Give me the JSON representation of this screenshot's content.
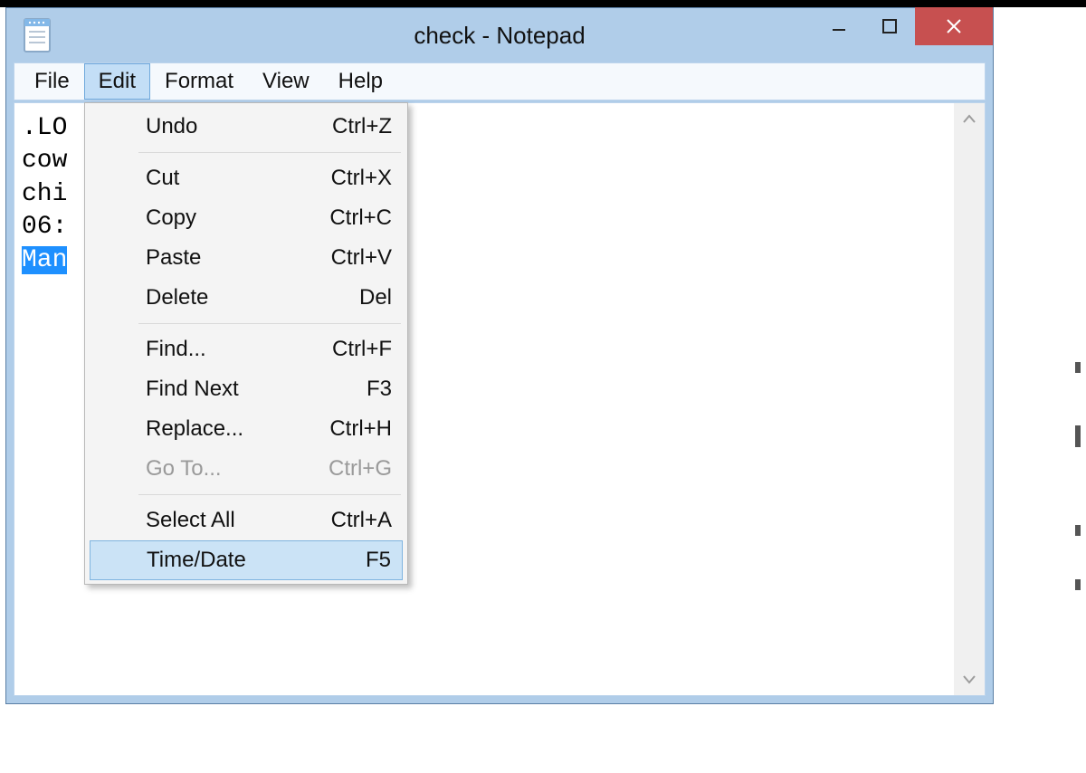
{
  "window": {
    "title": "check - Notepad"
  },
  "menubar": {
    "items": [
      {
        "label": "File"
      },
      {
        "label": "Edit"
      },
      {
        "label": "Format"
      },
      {
        "label": "View"
      },
      {
        "label": "Help"
      }
    ],
    "active_index": 1
  },
  "editor": {
    "lines": [
      ".LO",
      "cow",
      "chi",
      "06:"
    ],
    "selected_line": "Man"
  },
  "edit_menu": {
    "groups": [
      [
        {
          "label": "Undo",
          "shortcut": "Ctrl+Z",
          "enabled": true
        }
      ],
      [
        {
          "label": "Cut",
          "shortcut": "Ctrl+X",
          "enabled": true
        },
        {
          "label": "Copy",
          "shortcut": "Ctrl+C",
          "enabled": true
        },
        {
          "label": "Paste",
          "shortcut": "Ctrl+V",
          "enabled": true
        },
        {
          "label": "Delete",
          "shortcut": "Del",
          "enabled": true
        }
      ],
      [
        {
          "label": "Find...",
          "shortcut": "Ctrl+F",
          "enabled": true
        },
        {
          "label": "Find Next",
          "shortcut": "F3",
          "enabled": true
        },
        {
          "label": "Replace...",
          "shortcut": "Ctrl+H",
          "enabled": true
        },
        {
          "label": "Go To...",
          "shortcut": "Ctrl+G",
          "enabled": false
        }
      ],
      [
        {
          "label": "Select All",
          "shortcut": "Ctrl+A",
          "enabled": true
        },
        {
          "label": "Time/Date",
          "shortcut": "F5",
          "enabled": true,
          "highlight": true
        }
      ]
    ]
  }
}
